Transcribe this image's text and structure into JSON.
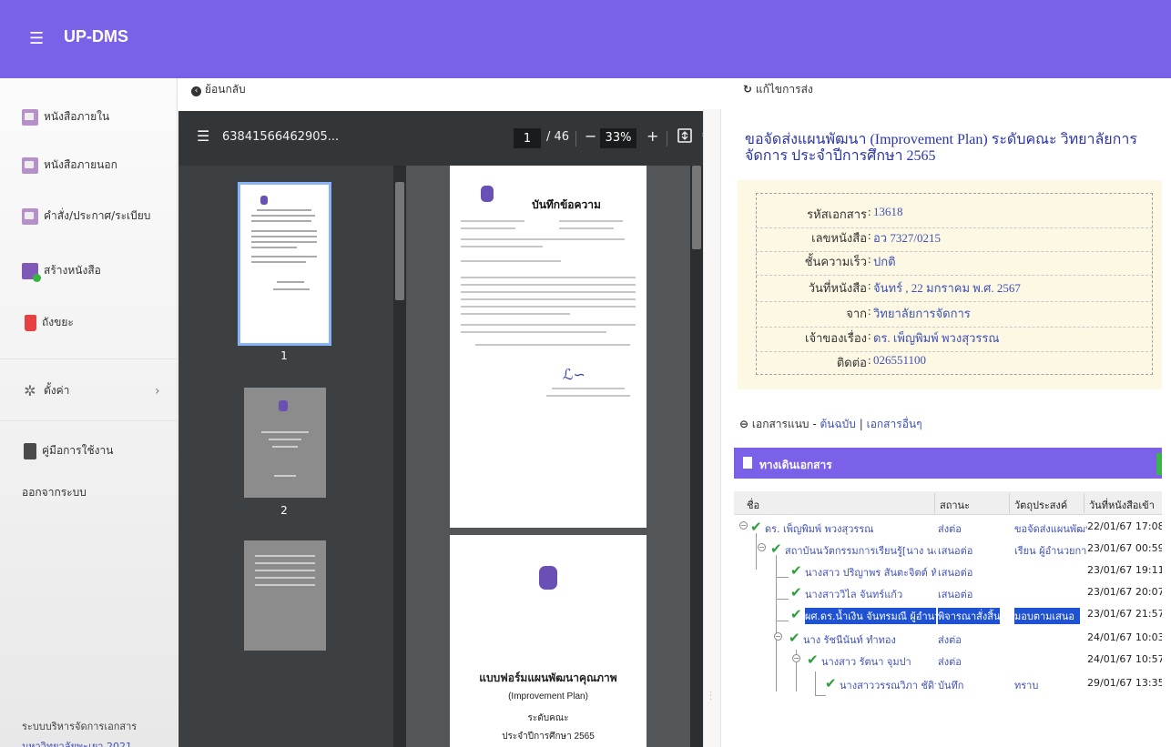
{
  "app": {
    "title": "UP-DMS",
    "menu_icon": "hamburger-icon",
    "accent": "#7b61e8"
  },
  "sidebar": {
    "items": [
      {
        "label": "หนังสือภายใน",
        "icon": "inbox-folder-icon"
      },
      {
        "label": "หนังสือภายนอก",
        "icon": "outbox-folder-icon"
      },
      {
        "label": "คำสั่ง/ประกาศ/ระเบียบ",
        "icon": "announcement-folder-icon"
      },
      {
        "label": "สร้างหนังสือ",
        "icon": "create-document-icon"
      },
      {
        "label": "ถังขยะ",
        "icon": "trash-icon"
      },
      {
        "label": "ตั้งค่า",
        "icon": "gear-icon"
      },
      {
        "label": "คู่มือการใช้งาน",
        "icon": "manual-icon"
      },
      {
        "label": "ออกจากระบบ"
      }
    ],
    "footer_line1": "ระบบบริหารจัดการเอกสาร",
    "footer_line2": "มหาวิทยาลัยพะเยา 2021"
  },
  "nav": {
    "back_label": "ย้อนกลับ",
    "edit_label": "แก้ไขการส่ง"
  },
  "pdf": {
    "filename": "63841566462905...",
    "current_page": "1",
    "page_total": "/ 46",
    "zoom": "33%",
    "thumbnail_numbers": [
      "1",
      "2"
    ],
    "page1_heading": "บันทึกข้อความ",
    "page2_title": "แบบฟอร์มแผนพัฒนาคุณภาพ",
    "page2_sub1": "(Improvement Plan)",
    "page2_sub2": "ระดับคณะ",
    "page2_sub3": "ประจำปีการศึกษา 2565"
  },
  "document": {
    "title": "ขอจัดส่งแผนพัฒนา (Improvement Plan) ระดับคณะ วิทยาลัยการจัดการ ประจำปีการศึกษา 2565",
    "fields": [
      {
        "label": "รหัสเอกสาร",
        "value": "13618"
      },
      {
        "label": "เลขหนังสือ",
        "value": "อว 7327/0215"
      },
      {
        "label": "ชั้นความเร็ว",
        "value": "ปกติ"
      },
      {
        "label": "วันที่หนังสือ",
        "value": "จันทร์ , 22 มกราคม พ.ศ. 2567"
      },
      {
        "label": "จาก",
        "value": "วิทยาลัยการจัดการ"
      },
      {
        "label": "เจ้าของเรื่อง",
        "value": "ดร. เพ็ญพิมพ์ พวงสุวรรณ"
      },
      {
        "label": "ติดต่อ",
        "value": "026551100"
      }
    ]
  },
  "attachments": {
    "label": "เอกสารแนบ -",
    "original": "ต้นฉบับ",
    "separator": "|",
    "other": "เอกสารอื่นๆ"
  },
  "flow": {
    "title": "ทางเดินเอกสาร",
    "columns": [
      "ชื่อ",
      "สถานะ",
      "วัตถุประสงค์",
      "วันที่หนังสือเข้า"
    ],
    "rows": [
      {
        "name": "ดร. เพ็ญพิมพ์ พวงสุวรรณ",
        "status": "ส่งต่อ",
        "purpose": "ขอจัดส่งแผนพัฒนา",
        "date": "22/01/67 17:08 ›"
      },
      {
        "name": "สถาบันนวัตกรรมการเรียนรู้[นาง นงลักษ",
        "status": "เสนอต่อ",
        "purpose": "เรียน ผู้อำนวยการ",
        "date": "23/01/67 00:59 ›"
      },
      {
        "name": "นางสาว ปริญาพร สันตะจิตต์ หัวหน้",
        "status": "เสนอต่อ",
        "purpose": "",
        "date": "23/01/67 19:11 ›"
      },
      {
        "name": "นางสาววิไล จันทร์แก้ว",
        "status": "เสนอต่อ",
        "purpose": "",
        "date": "23/01/67 20:07 ›"
      },
      {
        "name": "ผศ.ดร.น้ำเงิน จันทรมณี ผู้อำนวยกา",
        "status": "พิจารณาสั่งสิ้น",
        "purpose": "มอบตามเสนอ",
        "date": "23/01/67 21:57 ›"
      },
      {
        "name": "นาง รัชนีนันท์ ทำทอง",
        "status": "ส่งต่อ",
        "purpose": "",
        "date": "24/01/67 10:03 ›"
      },
      {
        "name": "นางสาว รัตนา จุมปา",
        "status": "ส่งต่อ",
        "purpose": "",
        "date": "24/01/67 10:57 ›"
      },
      {
        "name": "นางสาววรรณวิภา ชัดิวงศ์",
        "status": "บันทึก",
        "purpose": "ทราบ",
        "date": "29/01/67 13:35 ›"
      }
    ]
  }
}
